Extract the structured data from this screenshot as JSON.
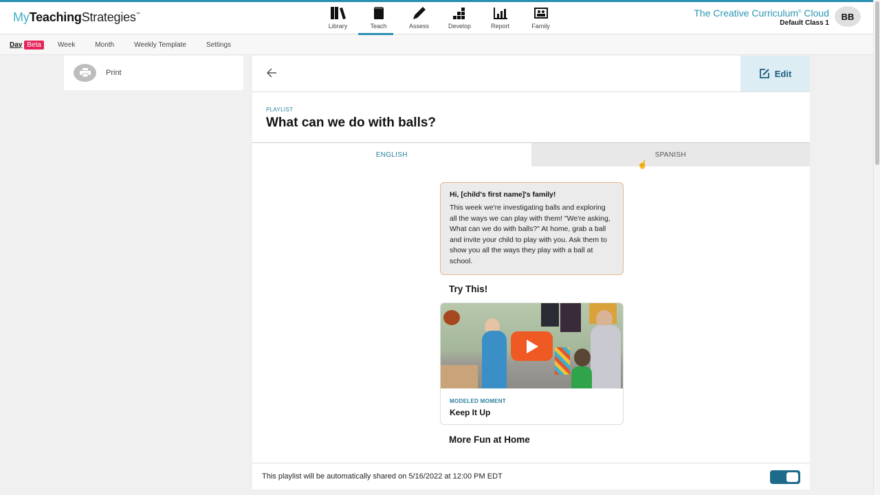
{
  "header": {
    "logo": {
      "my": "My",
      "teaching": "Teaching",
      "strategies": "Strategies",
      "tm": "™"
    },
    "nav": [
      {
        "label": "Library",
        "icon": "library-icon",
        "active": false
      },
      {
        "label": "Teach",
        "icon": "book-icon",
        "active": true
      },
      {
        "label": "Assess",
        "icon": "pencil-icon",
        "active": false
      },
      {
        "label": "Develop",
        "icon": "blocks-icon",
        "active": false
      },
      {
        "label": "Report",
        "icon": "bar-chart-icon",
        "active": false
      },
      {
        "label": "Family",
        "icon": "family-icon",
        "active": false
      }
    ],
    "brand": {
      "name": "The Creative Curriculum",
      "reg": "®",
      "suffix": "Cloud"
    },
    "class_name": "Default Class 1",
    "avatar_initials": "BB"
  },
  "subnav": {
    "day": "Day",
    "beta": "Beta",
    "items": [
      "Week",
      "Month",
      "Weekly Template",
      "Settings"
    ]
  },
  "left_panel": {
    "print_label": "Print"
  },
  "toolbar": {
    "back_icon": "arrow-left-icon",
    "edit_label": "Edit"
  },
  "playlist": {
    "eyebrow": "PLAYLIST",
    "title": "What can we do with balls?",
    "tabs": [
      {
        "label": "ENGLISH",
        "active": true
      },
      {
        "label": "SPANISH",
        "active": false
      }
    ],
    "message": {
      "greeting": "Hi, [child's first name]'s family!",
      "body": "This week we're investigating balls and exploring all the ways we can play with them! \"We're asking, What can we do with balls?\" At home, grab a ball and invite your child to play with you. Ask them to show you all the ways they play with a ball at school."
    },
    "try_this_heading": "Try This!",
    "video": {
      "eyebrow": "MODELED MOMENT",
      "title": "Keep It Up"
    },
    "more_heading": "More Fun at Home"
  },
  "footer": {
    "share_text": "This playlist will be automatically shared on 5/16/2022 at 12:00 PM EDT",
    "auto_share_enabled": true
  },
  "colors": {
    "accent": "#2a8fb0",
    "beta": "#e5245a",
    "play": "#ef5a24",
    "toggle": "#1d6a8a",
    "edit_bg": "#dcedf4"
  }
}
